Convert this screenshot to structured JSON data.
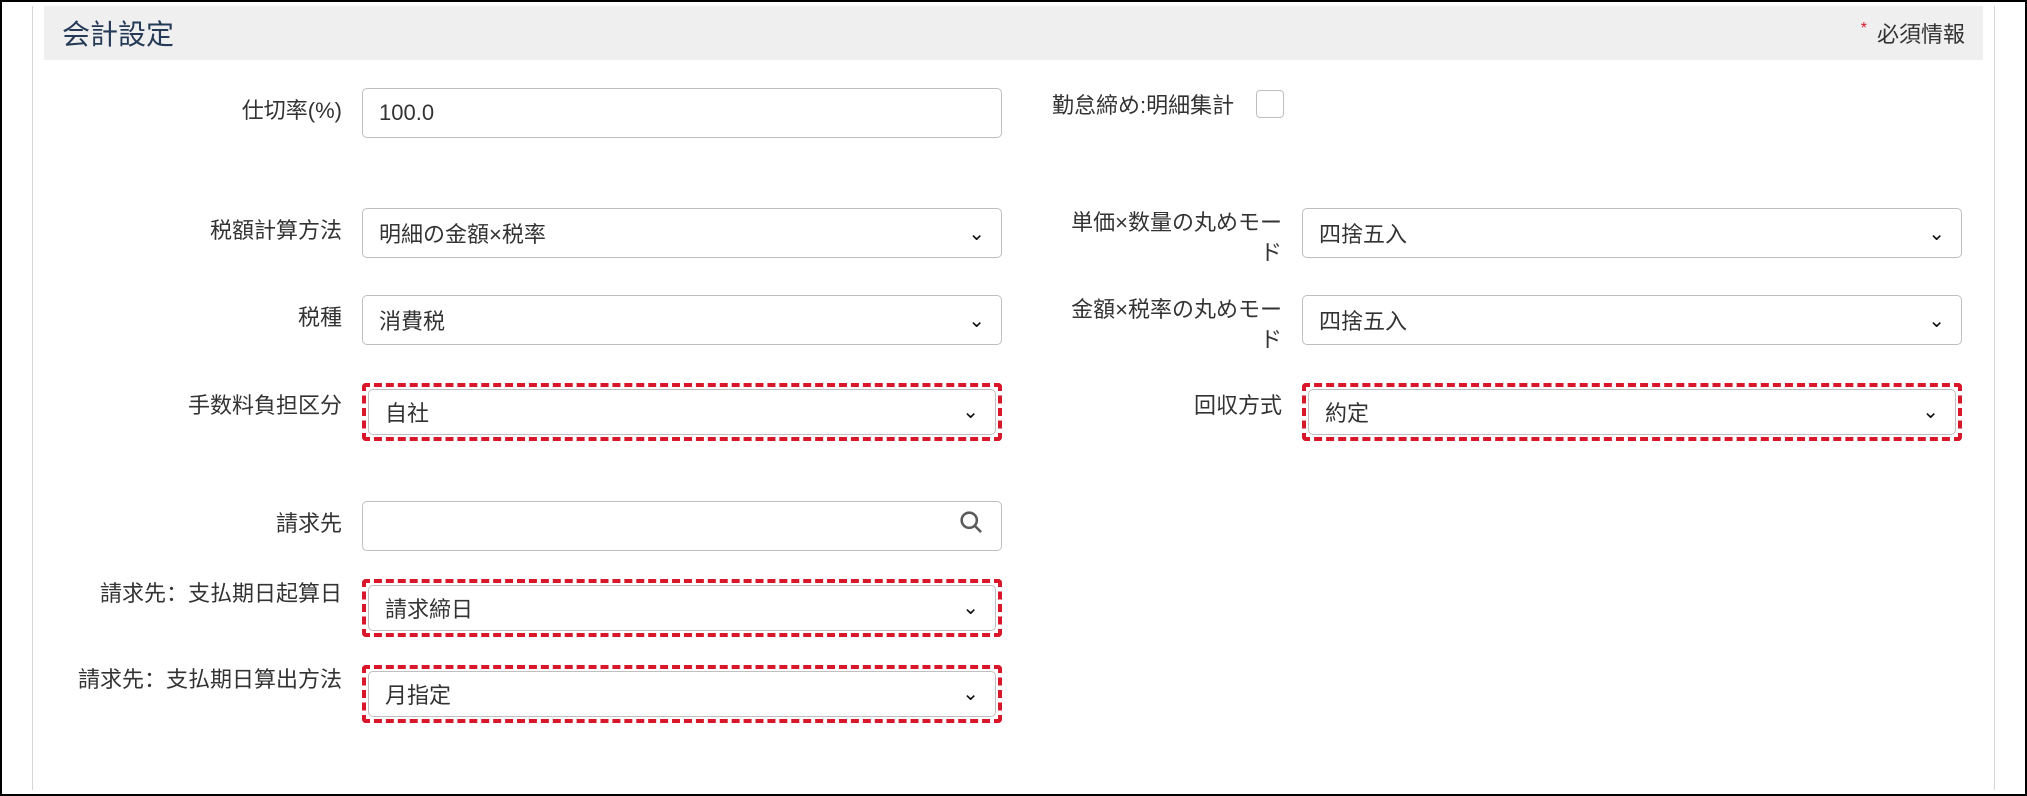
{
  "section": {
    "title": "会計設定",
    "required_label": "必須情報"
  },
  "fields": {
    "commission_rate": {
      "label": "仕切率(%)",
      "value": "100.0"
    },
    "attendance_detail": {
      "label": "勤怠締め:明細集計"
    },
    "tax_calc_method": {
      "label": "税額計算方法",
      "value": "明細の金額×税率"
    },
    "unit_qty_round": {
      "label": "単価×数量の丸めモード",
      "value": "四捨五入"
    },
    "tax_type": {
      "label": "税種",
      "value": "消費税"
    },
    "amount_rate_round": {
      "label": "金額×税率の丸めモード",
      "value": "四捨五入"
    },
    "fee_burden": {
      "label": "手数料負担区分",
      "value": "自社"
    },
    "collection_method": {
      "label": "回収方式",
      "value": "約定"
    },
    "billing_dest": {
      "label": "請求先",
      "value": ""
    },
    "payment_due_start": {
      "label": "請求先：支払期日起算日",
      "value": "請求締日"
    },
    "payment_due_calc": {
      "label": "請求先：支払期日算出方法",
      "value": "月指定"
    }
  }
}
